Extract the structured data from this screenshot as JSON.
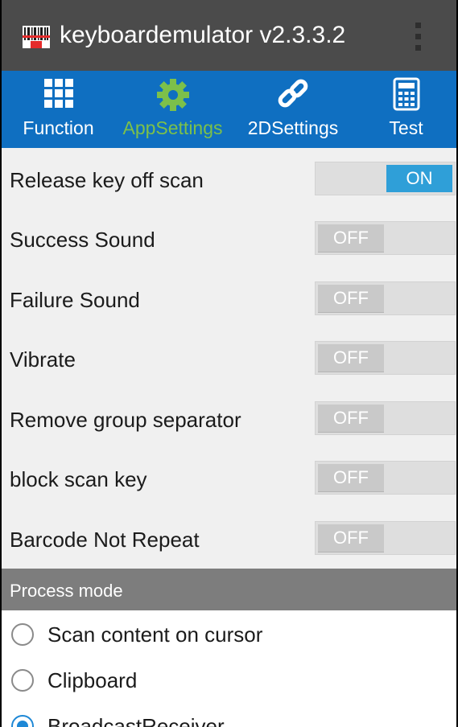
{
  "app": {
    "title": "keyboardemulator v2.3.3.2",
    "icon": "barcode-scanner-icon",
    "menu_icon": "overflow-menu-icon"
  },
  "tabs": [
    {
      "label": "Function",
      "icon": "grid-icon",
      "active": false
    },
    {
      "label": "AppSettings",
      "icon": "gear-icon",
      "active": true
    },
    {
      "label": "2DSettings",
      "icon": "link-icon",
      "active": false
    },
    {
      "label": "Test",
      "icon": "calculator-icon",
      "active": false
    }
  ],
  "settings": [
    {
      "label": "Release key off scan",
      "state": "ON"
    },
    {
      "label": "Success Sound",
      "state": "OFF"
    },
    {
      "label": "Failure Sound",
      "state": "OFF"
    },
    {
      "label": "Vibrate",
      "state": "OFF"
    },
    {
      "label": "Remove group separator",
      "state": "OFF"
    },
    {
      "label": "block scan key",
      "state": "OFF"
    },
    {
      "label": "Barcode Not Repeat",
      "state": "OFF"
    }
  ],
  "process_mode": {
    "header": "Process mode",
    "options": [
      {
        "label": "Scan content on cursor",
        "selected": false
      },
      {
        "label": "Clipboard",
        "selected": false
      },
      {
        "label": "BroadcastReceiver",
        "selected": true
      }
    ]
  },
  "colors": {
    "actionbar": "#4b4b4b",
    "tabbar": "#0f6fc1",
    "active_tab": "#7cc04a",
    "toggle_on": "#2f9fd8"
  }
}
